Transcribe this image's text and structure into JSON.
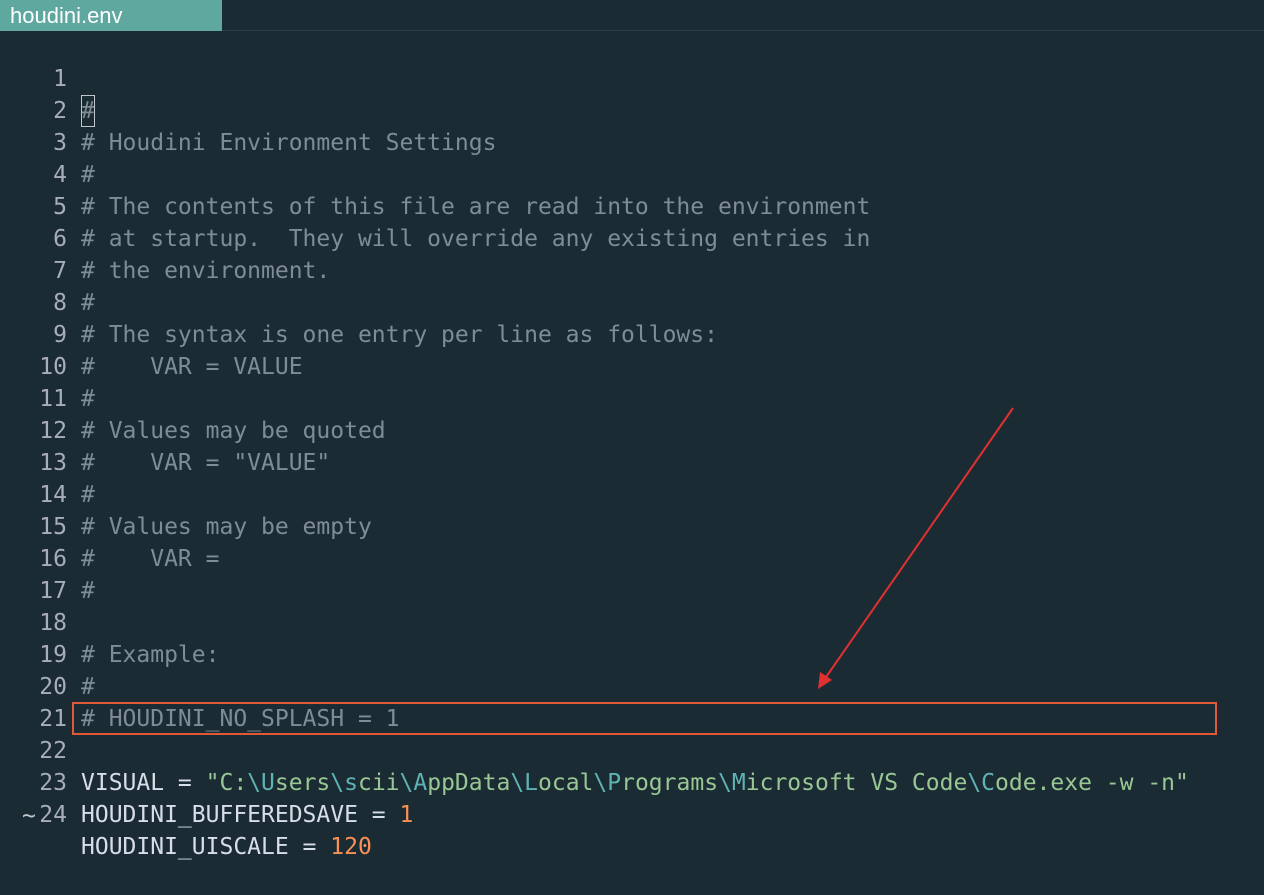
{
  "tab": {
    "title": "houdini.env"
  },
  "lines": [
    {
      "n": "1",
      "kind": "comment",
      "text": "#"
    },
    {
      "n": "2",
      "kind": "comment",
      "text": "# Houdini Environment Settings"
    },
    {
      "n": "3",
      "kind": "comment",
      "text": "#"
    },
    {
      "n": "4",
      "kind": "comment",
      "text": "# The contents of this file are read into the environment"
    },
    {
      "n": "5",
      "kind": "comment",
      "text": "# at startup.  They will override any existing entries in"
    },
    {
      "n": "6",
      "kind": "comment",
      "text": "# the environment."
    },
    {
      "n": "7",
      "kind": "comment",
      "text": "#"
    },
    {
      "n": "8",
      "kind": "comment",
      "text": "# The syntax is one entry per line as follows:"
    },
    {
      "n": "9",
      "kind": "comment",
      "text": "#    VAR = VALUE"
    },
    {
      "n": "10",
      "kind": "comment",
      "text": "#"
    },
    {
      "n": "11",
      "kind": "comment",
      "text": "# Values may be quoted"
    },
    {
      "n": "12",
      "kind": "comment",
      "text": "#    VAR = \"VALUE\""
    },
    {
      "n": "13",
      "kind": "comment",
      "text": "#"
    },
    {
      "n": "14",
      "kind": "comment",
      "text": "# Values may be empty"
    },
    {
      "n": "15",
      "kind": "comment",
      "text": "#    VAR ="
    },
    {
      "n": "16",
      "kind": "comment",
      "text": "#"
    },
    {
      "n": "17",
      "kind": "comment",
      "text": ""
    },
    {
      "n": "18",
      "kind": "comment",
      "text": "# Example:"
    },
    {
      "n": "19",
      "kind": "comment",
      "text": "#"
    },
    {
      "n": "20",
      "kind": "comment",
      "text": "# HOUDINI_NO_SPLASH = 1"
    },
    {
      "n": "21",
      "kind": "comment",
      "text": ""
    },
    {
      "n": "22",
      "kind": "visual",
      "parts": [
        {
          "t": "VISUAL = ",
          "c": "ident"
        },
        {
          "t": "\"C:",
          "c": "str"
        },
        {
          "t": "\\U",
          "c": "path"
        },
        {
          "t": "sers",
          "c": "str"
        },
        {
          "t": "\\s",
          "c": "path"
        },
        {
          "t": "cii",
          "c": "str"
        },
        {
          "t": "\\A",
          "c": "path"
        },
        {
          "t": "ppData",
          "c": "str"
        },
        {
          "t": "\\L",
          "c": "path"
        },
        {
          "t": "ocal",
          "c": "str"
        },
        {
          "t": "\\P",
          "c": "path"
        },
        {
          "t": "rograms",
          "c": "str"
        },
        {
          "t": "\\M",
          "c": "path"
        },
        {
          "t": "icrosoft VS Code",
          "c": "str"
        },
        {
          "t": "\\C",
          "c": "path"
        },
        {
          "t": "ode.exe -w -n\"",
          "c": "str"
        }
      ]
    },
    {
      "n": "23",
      "kind": "assign",
      "name": "HOUDINI_BUFFEREDSAVE = ",
      "value": "1"
    },
    {
      "n": "24",
      "kind": "assign",
      "name": "HOUDINI_UISCALE = ",
      "value": "120"
    }
  ],
  "end_marker": "~",
  "colors": {
    "background": "#1b2b34",
    "tab": "#5fa8a0",
    "comment": "#7f8c96",
    "string": "#99c794",
    "escape": "#5fb3b3",
    "number": "#f99157",
    "annotation": "#e05a3a"
  }
}
